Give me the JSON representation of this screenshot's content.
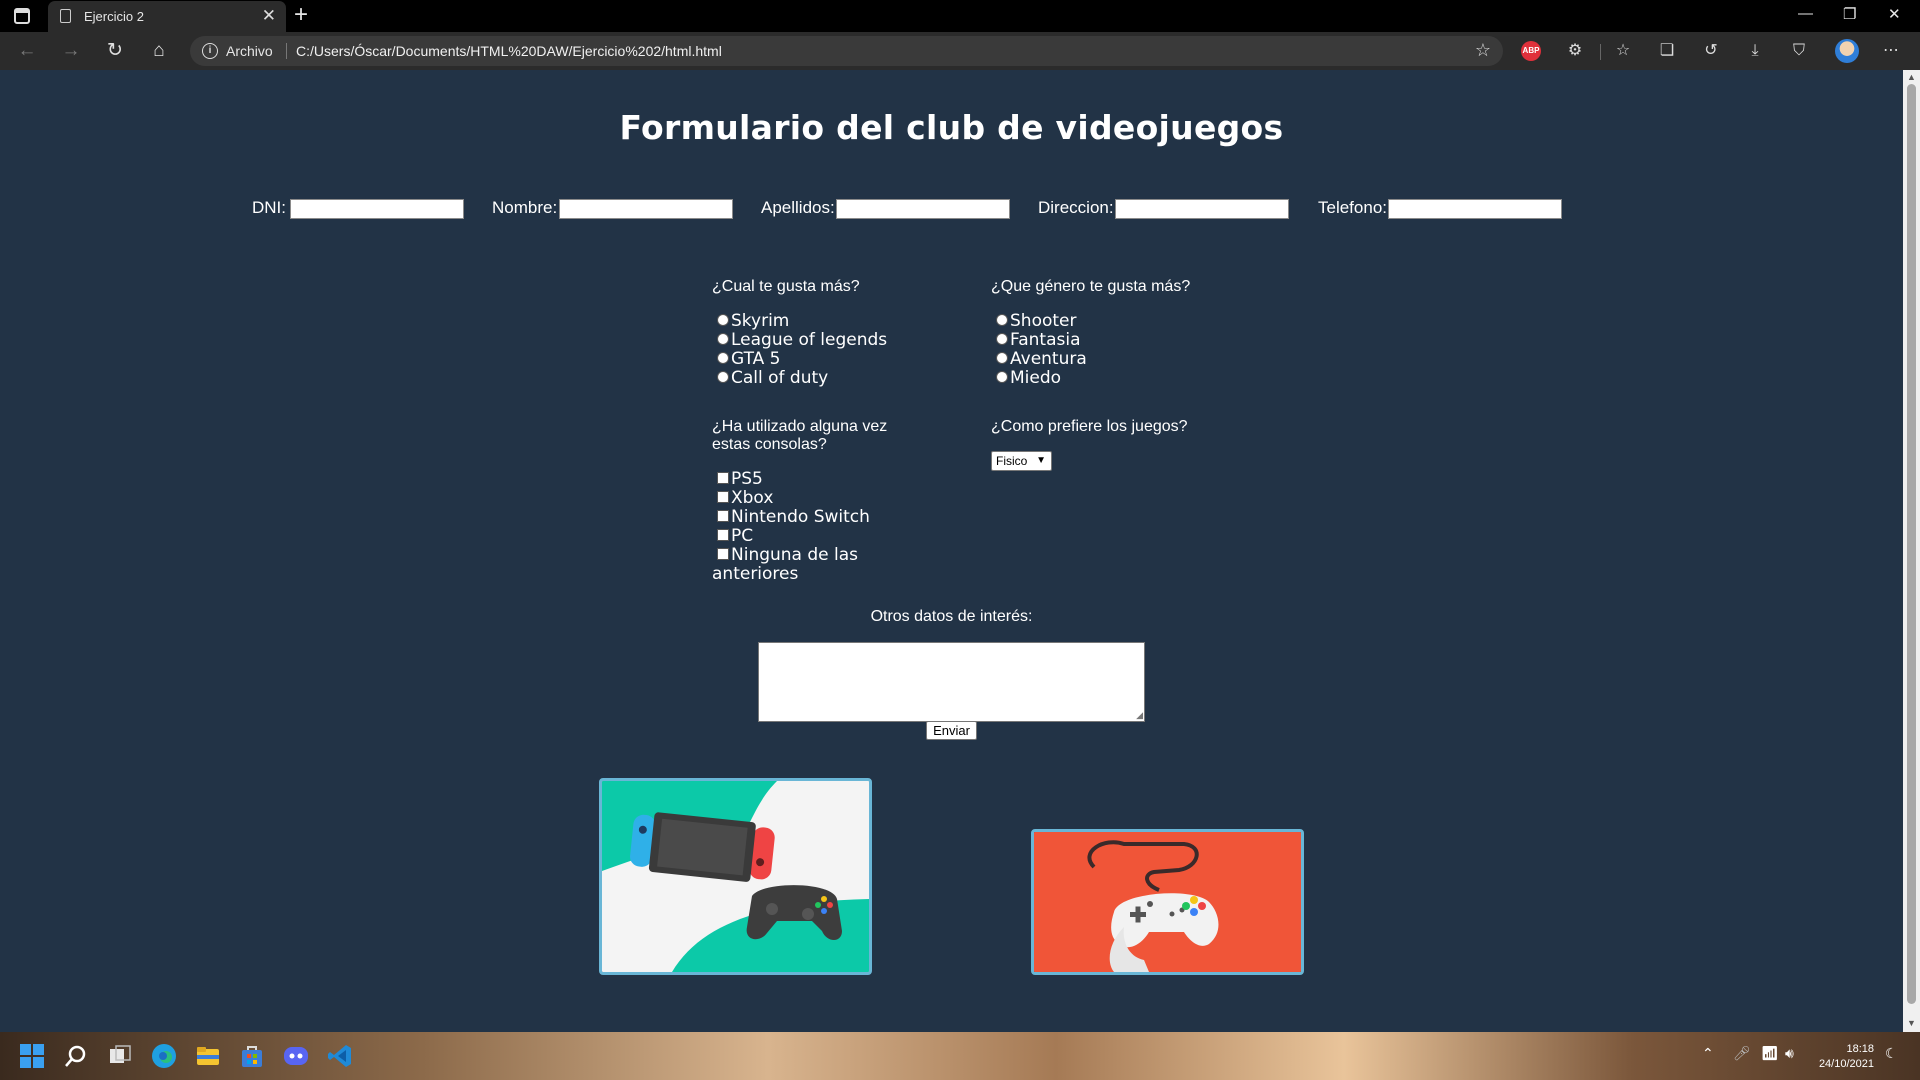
{
  "browser": {
    "tab_title": "Ejercicio 2",
    "url_label": "Archivo",
    "url": "C:/Users/Óscar/Documents/HTML%20DAW/Ejercicio%202/html.html",
    "extension_badge": "ABP"
  },
  "page": {
    "title": "Formulario del club de videojuegos",
    "fields": [
      {
        "label": "DNI:",
        "value": ""
      },
      {
        "label": "Nombre:",
        "value": ""
      },
      {
        "label": "Apellidos:",
        "value": ""
      },
      {
        "label": "Direccion:",
        "value": ""
      },
      {
        "label": "Telefono:",
        "value": ""
      }
    ],
    "q_games": "¿Cual te gusta más?",
    "games": [
      "Skyrim",
      "League of legends",
      "GTA 5",
      "Call of duty"
    ],
    "q_genres": "¿Que género te gusta más?",
    "genres": [
      "Shooter",
      "Fantasia",
      "Aventura",
      "Miedo"
    ],
    "q_consoles_line1": "¿Ha utilizado alguna vez",
    "q_consoles_line2": "estas consolas?",
    "consoles": [
      "PS5",
      "Xbox",
      "Nintendo Switch",
      "PC",
      "Ninguna de las",
      "anteriores"
    ],
    "q_format": "¿Como prefiere los juegos?",
    "format_selected": "Fisico",
    "other_label": "Otros datos de interés:",
    "submit_label": "Enviar"
  },
  "taskbar": {
    "time": "18:18",
    "date": "24/10/2021"
  },
  "colors": {
    "page_bg": "#223346",
    "card_border": "#69b6d6",
    "switch_card_teal": "#0cc9a8",
    "controller_card_red": "#f05538"
  }
}
